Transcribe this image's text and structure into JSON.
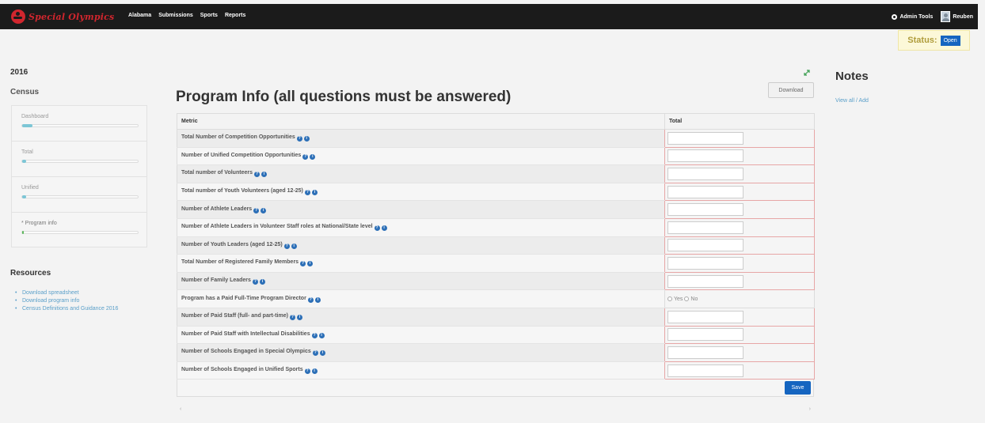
{
  "nav": {
    "brand": "Special Olympics",
    "links": [
      "Alabama",
      "Submissions",
      "Sports",
      "Reports"
    ],
    "admin_tools": "Admin Tools",
    "user": "Reuben"
  },
  "status": {
    "label": "Status:",
    "value": "Open"
  },
  "sidebar": {
    "year": "2016",
    "census_title": "Census",
    "items": [
      {
        "label": "Dashboard",
        "progress": 0.1
      },
      {
        "label": "Total",
        "progress": 0.03
      },
      {
        "label": "Unified",
        "progress": 0.03
      },
      {
        "label": "* Program info",
        "progress": 0.0
      }
    ],
    "resources_title": "Resources",
    "resources": [
      "Download spreadsheet",
      "Download program info",
      "Census Definitions and Guidance 2016"
    ]
  },
  "main": {
    "title": "Program Info (all questions must be answered)",
    "download_label": "Download",
    "columns": [
      "Metric",
      "Total"
    ],
    "rows": [
      {
        "metric": "Total Number of Competition Opportunities",
        "type": "text",
        "value": ""
      },
      {
        "metric": "Number of Unified Competition Opportunities",
        "type": "text",
        "value": ""
      },
      {
        "metric": "Total number of Volunteers",
        "type": "text",
        "value": ""
      },
      {
        "metric": "Total number of Youth Volunteers (aged 12-25)",
        "type": "text",
        "value": ""
      },
      {
        "metric": "Number of Athlete Leaders",
        "type": "text",
        "value": ""
      },
      {
        "metric": "Number of Athlete Leaders in Volunteer Staff roles at National/State level",
        "type": "text",
        "value": ""
      },
      {
        "metric": "Number of Youth Leaders (aged 12-25)",
        "type": "text",
        "value": ""
      },
      {
        "metric": "Total Number of Registered Family Members",
        "type": "text",
        "value": ""
      },
      {
        "metric": "Number of Family Leaders",
        "type": "text",
        "value": ""
      },
      {
        "metric": "Program has a Paid Full-Time Program Director",
        "type": "radio",
        "options": [
          "Yes",
          "No"
        ]
      },
      {
        "metric": "Number of Paid Staff (full- and part-time)",
        "type": "text",
        "value": ""
      },
      {
        "metric": "Number of Paid Staff with Intellectual Disabilities",
        "type": "text",
        "value": ""
      },
      {
        "metric": "Number of Schools Engaged in Special Olympics",
        "type": "text",
        "value": ""
      },
      {
        "metric": "Number of Schools Engaged in Unified Sports",
        "type": "text",
        "value": ""
      }
    ],
    "save_label": "Save",
    "scroll_left": "‹",
    "scroll_right": "›"
  },
  "notes": {
    "title": "Notes",
    "link": "View all / Add"
  },
  "colors": {
    "nav_bg": "#1b1b1b",
    "brand_red": "#d1262e",
    "primary_blue": "#1565c0",
    "link_blue": "#5a9fc9",
    "required_border": "#e7a6a6"
  }
}
